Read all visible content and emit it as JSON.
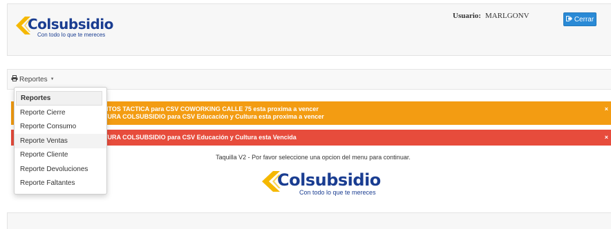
{
  "header": {
    "logo": {
      "wordmark": "Colsubsidio",
      "tagline": "Con todo lo que te mereces"
    },
    "user_label": "Usuario:",
    "username": "MARLGONV",
    "logout_label": "Cerrar",
    "logout_icon": "sign-out-icon"
  },
  "menu": {
    "toggle_label": "Reportes",
    "toggle_icon": "print-icon",
    "items": [
      {
        "label": "Reportes",
        "state": "header"
      },
      {
        "label": "Reporte Cierre"
      },
      {
        "label": "Reporte Consumo"
      },
      {
        "label": "Reporte Ventas",
        "state": "hover"
      },
      {
        "label": "Reporte Cliente"
      },
      {
        "label": "Reporte Devoluciones"
      },
      {
        "label": "Reporte Faltantes"
      }
    ]
  },
  "alerts": [
    {
      "type": "warning",
      "color": "#f39c12",
      "lines": [
        "NTOS TACTICA para CSV COWORKING CALLE 75 esta proxima a vencer",
        "TURA COLSUBSIDIO para CSV Educación y Cultura esta proxima a vencer"
      ]
    },
    {
      "type": "danger",
      "color": "#e74c3c",
      "lines": [
        "TURA COLSUBSIDIO para CSV Educación y Cultura esta Vencida"
      ]
    }
  ],
  "alert_close": "×",
  "main": {
    "welcome": "Taquilla V2 - Por favor seleccione una opcion del menu para continuar.",
    "logo": {
      "wordmark": "Colsubsidio",
      "tagline": "Con todo lo que te mereces"
    }
  },
  "colors": {
    "brand_blue": "#1a3d91",
    "brand_yellow": "#f5b800",
    "primary_button": "#2a8ad6"
  }
}
